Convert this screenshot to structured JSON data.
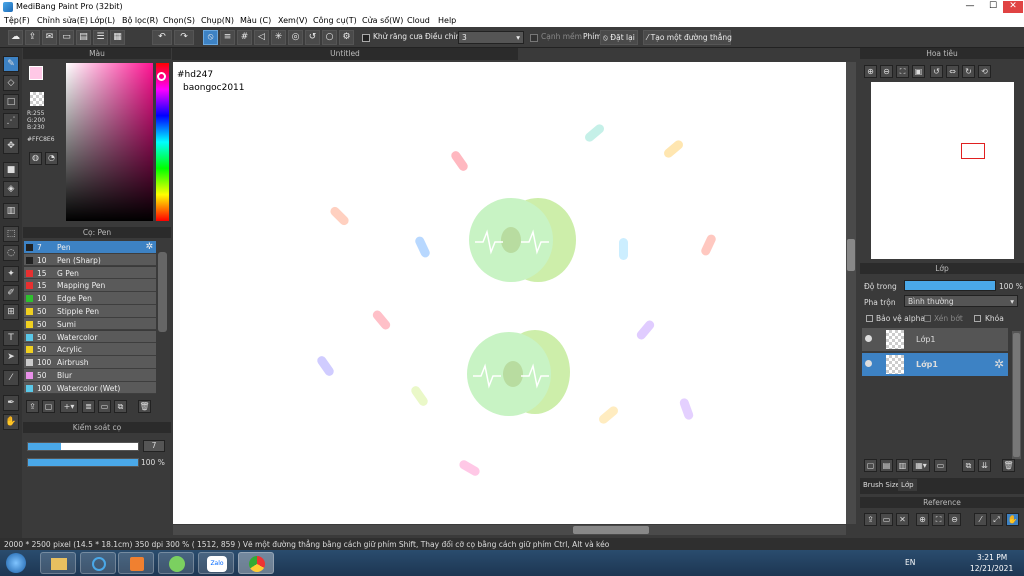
{
  "window": {
    "title": "MediBang Paint Pro (32bit)",
    "minimize": "—",
    "maximize": "☐",
    "close": "✕"
  },
  "menu": [
    "Tệp(F)",
    "Chỉnh sửa(E)",
    "Lớp(L)",
    "Bộ lọc(R)",
    "Chọn(S)",
    "Chụp(N)",
    "Màu (C)",
    "Xem(V)",
    "Công cụ(T)",
    "Cửa sổ(W)",
    "Cloud",
    "Help"
  ],
  "toolbar": {
    "antialias": "Khử răng cưa",
    "adjust_label": "Điều chỉnh",
    "adjust_value": "3",
    "edge": "Cạnh mềm",
    "key_label": "Phím",
    "reset": "Đặt lại",
    "make_line": "Tạo một đường thẳng"
  },
  "color_panel": {
    "title": "Màu",
    "r": "R:255",
    "g": "G:200",
    "b": "B:230",
    "hex": "#FFC8E6",
    "fg": "#ffc8e6"
  },
  "brush_panel": {
    "title": "Cọ: Pen",
    "items": [
      {
        "size": "7",
        "name": "Pen",
        "color": "#222222"
      },
      {
        "size": "10",
        "name": "Pen (Sharp)",
        "color": "#222222"
      },
      {
        "size": "15",
        "name": "G Pen",
        "color": "#e83030"
      },
      {
        "size": "15",
        "name": "Mapping Pen",
        "color": "#e83030"
      },
      {
        "size": "10",
        "name": "Edge Pen",
        "color": "#2ec02e"
      },
      {
        "size": "50",
        "name": "Stipple Pen",
        "color": "#f0d020"
      },
      {
        "size": "50",
        "name": "Sumi",
        "color": "#f0d020"
      },
      {
        "size": "50",
        "name": "Watercolor",
        "color": "#5ac8e8"
      },
      {
        "size": "50",
        "name": "Acrylic",
        "color": "#f0d020"
      },
      {
        "size": "100",
        "name": "Airbrush",
        "color": "#cccccc"
      },
      {
        "size": "50",
        "name": "Blur",
        "color": "#e890e8"
      },
      {
        "size": "100",
        "name": "Watercolor (Wet)",
        "color": "#5ac8e8"
      }
    ]
  },
  "brush_control": {
    "title": "Kiểm soát cọ",
    "size": "7",
    "opacity": "100 %",
    "size_level": 0.3,
    "opacity_level": 1.0
  },
  "canvas": {
    "tab": "Untitled",
    "line1": "#hd247",
    "line2": "baongoc2011"
  },
  "navigator": {
    "title": "Hoa tiêu"
  },
  "layer_panel": {
    "title": "Lớp",
    "opacity_label": "Độ trong",
    "opacity_value": "100 %",
    "blend_label": "Pha trộn",
    "blend_value": "Bình thường",
    "protect_alpha": "Bảo vệ alpha",
    "clipping": "Xén bớt",
    "lock": "Khóa",
    "layers": [
      {
        "name": "Lớp1"
      },
      {
        "name": "Lớp1"
      }
    ],
    "tab_brush_size": "Brush Size",
    "tab_layer": "Lớp"
  },
  "reference": {
    "title": "Reference"
  },
  "status": {
    "text": "2000 * 2500 pixel   (14.5 * 18.1cm)   350 dpi   300 %   ( 1512, 859 )   Vẽ một đường thẳng bằng cách giữ phím Shift, Thay đổi cỡ cọ bằng cách giữ phím Ctrl, Alt và kéo"
  },
  "taskbar": {
    "lang": "EN",
    "time": "3:21 PM",
    "date": "12/21/2021",
    "zalo": "Zalo"
  }
}
